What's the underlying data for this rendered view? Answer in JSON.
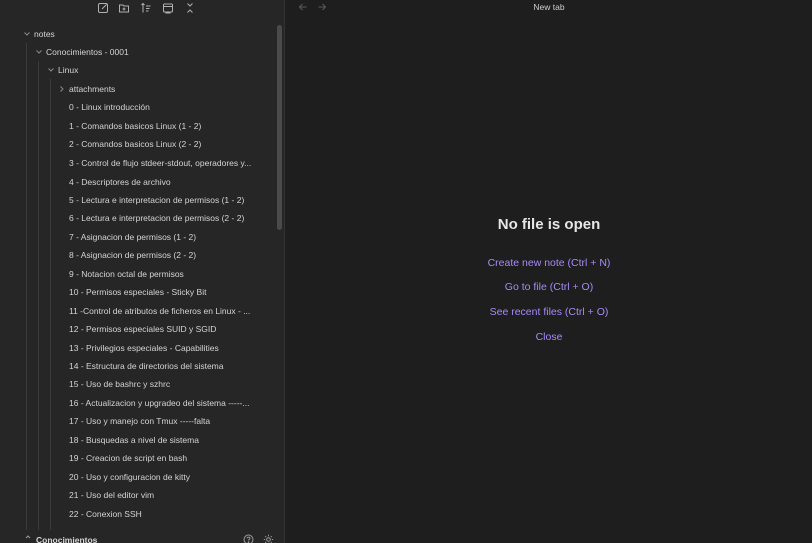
{
  "sidebar": {
    "toolbar": {
      "icons": [
        "new-note-icon",
        "new-folder-icon",
        "sort-icon",
        "collapse-view-icon",
        "collapse-all-icon"
      ]
    },
    "tree": {
      "root": "notes",
      "folder": "Conocimientos - 0001",
      "subfolder": "Linux",
      "attachments": "attachments",
      "files": [
        "0 - Linux introducción",
        "1 - Comandos basicos Linux (1 - 2)",
        "2 - Comandos basicos  Linux (2 - 2)",
        "3 - Control de flujo stdeer-stdout, operadores y...",
        "4 - Descriptores de archivo",
        "5 - Lectura e interpretacion de permisos (1 - 2)",
        "6 - Lectura e interpretacion de permisos (2 - 2)",
        "7 - Asignacion de permisos (1 - 2)",
        "8 - Asignacion de permisos (2 - 2)",
        "9 - Notacion octal de permisos",
        "10 - Permisos especiales - Sticky Bit",
        "11 -Control de atributos de ficheros en Linux - ...",
        "12 - Permisos especiales SUID y SGID",
        "13 - Privilegios especiales - Capabilities",
        "14 - Estructura de directorios del sistema",
        "15 - Uso de bashrc y szhrc",
        "16 - Actualizacion y upgradeo del sistema -----...",
        "17 - Uso y manejo con Tmux -----falta",
        "18 - Busquedas a nivel de sistema",
        "19 - Creacion de script en bash",
        "20 - Uso y configuracion de kitty",
        "21 - Uso del editor vim",
        "22 - Conexion SSH"
      ]
    },
    "footer": {
      "vault_name": "Conocimientos"
    }
  },
  "main": {
    "tab_title": "New tab",
    "empty_state": {
      "title": "No file is open",
      "actions": [
        "Create new note (Ctrl + N)",
        "Go to file (Ctrl + O)",
        "See recent files (Ctrl + O)",
        "Close"
      ]
    }
  },
  "colors": {
    "accent": "#a68af9",
    "sidebar_bg": "#262626",
    "main_bg": "#1e1e1e"
  }
}
